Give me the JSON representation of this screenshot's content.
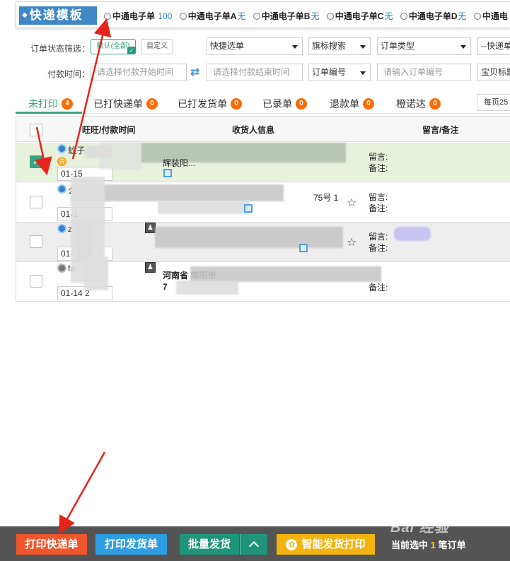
{
  "template_bar": {
    "title": "快递模板",
    "options": [
      {
        "label": "中通电子单",
        "tag": "100"
      },
      {
        "label": "中通电子单A",
        "tag": "无"
      },
      {
        "label": "中通电子单B",
        "tag": "无"
      },
      {
        "label": "中通电子单C",
        "tag": "无"
      },
      {
        "label": "中通电子单D",
        "tag": "无"
      },
      {
        "label": "中通电",
        "tag": ""
      }
    ]
  },
  "filters": {
    "status_label": "订单状态筛选：",
    "default_all": "默认(全部)",
    "custom": "自定义",
    "quick_select": "快捷选单",
    "flag_search": "旗标搜索",
    "order_type": "订单类型",
    "express_cut": "--快递单",
    "pay_time_label": "付款时间：",
    "pay_start_placeholder": "请选择付款开始时间",
    "pay_end_placeholder": "请选择付款结束时间",
    "order_no_select": "订单编号",
    "order_no_placeholder": "请输入订单编号",
    "baby_tag": "宝贝标题"
  },
  "tabs": [
    {
      "label": "未打印",
      "count": "4"
    },
    {
      "label": "已打快递单",
      "count": "0"
    },
    {
      "label": "已打发货单",
      "count": "0"
    },
    {
      "label": "已录单",
      "count": "0"
    },
    {
      "label": "退款单",
      "count": "0"
    },
    {
      "label": "橙诺达",
      "count": "0"
    }
  ],
  "per_page": "每页25",
  "table": {
    "headers": {
      "wangwang": "旺旺/付款时间",
      "receiver": "收货人信息",
      "message": "留言/备注"
    },
    "rows": [
      {
        "name": "蚊子",
        "he": "合",
        "date": "01-15",
        "addr1": "辉装阳...",
        "addr_extra": "",
        "msg": "留言:",
        "note": "备注:"
      },
      {
        "name": "么",
        "date": "01-1",
        "addr1": "",
        "addr_extra": "75号 1",
        "msg": "留言:",
        "note": "备注:"
      },
      {
        "name": "z",
        "date": "01-",
        "addr1": "",
        "addr_extra": "",
        "msg": "留言:",
        "note": "备注:"
      },
      {
        "name": "fa",
        "date": "01-14 2",
        "addr1": "河南省 南阳市",
        "addr2": "7",
        "addr_extra": "",
        "msg": "",
        "note": "备注:"
      }
    ]
  },
  "bottom": {
    "print_express": "打印快递单",
    "print_invoice": "打印发货单",
    "batch_ship": "批量发货",
    "expand": "^",
    "smart_print": "智能发货打印",
    "selected_prefix": "当前选中",
    "selected_count": "1",
    "selected_suffix": "笔订单"
  },
  "watermark": "Bai 经验",
  "colors": {
    "accent_green": "#3aa37f",
    "orange": "#ff6a00",
    "red_button": "#f0562b",
    "blue_button": "#2e9ee3",
    "yellow_button": "#f3b40f",
    "template_blue": "#3f88c5"
  }
}
